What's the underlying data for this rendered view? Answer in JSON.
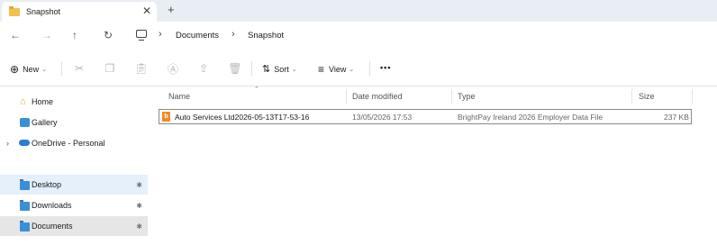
{
  "tab": {
    "title": "Snapshot",
    "close": "✕",
    "new_tab": "+"
  },
  "nav": {
    "back": "←",
    "forward": "→",
    "up": "↑",
    "refresh": "↻"
  },
  "breadcrumb": {
    "sep": "›",
    "items": [
      "Documents",
      "Snapshot"
    ]
  },
  "toolbar": {
    "new_label": "New",
    "new_icon": "⊕",
    "sort_label": "Sort",
    "sort_icon": "⇅",
    "view_label": "View",
    "view_icon": "≡",
    "more": "•••",
    "chevron": "⌄",
    "icons": [
      "cut-icon",
      "copy-icon",
      "paste-icon",
      "rename-icon",
      "share-icon",
      "delete-icon"
    ]
  },
  "sidebar": {
    "pin": "✱",
    "expand": "›",
    "items": [
      {
        "label": "Home",
        "icon": "home-icon"
      },
      {
        "label": "Gallery",
        "icon": "gallery-icon"
      },
      {
        "label": "OneDrive - Personal",
        "icon": "cloud-icon"
      },
      {
        "label": "Desktop",
        "icon": "desktop-folder-icon",
        "pinned": true
      },
      {
        "label": "Downloads",
        "icon": "downloads-folder-icon",
        "pinned": true
      },
      {
        "label": "Documents",
        "icon": "documents-folder-icon",
        "pinned": true
      }
    ]
  },
  "columns": {
    "name": "Name",
    "date": "Date modified",
    "type": "Type",
    "size": "Size"
  },
  "files": [
    {
      "name": "Auto Services Ltd2026-05-13T17-53-16",
      "icon_glyph": "b",
      "date": "13/05/2026 17:53",
      "type": "BrightPay Ireland 2026 Employer Data File",
      "size": "237 KB"
    }
  ],
  "colors": {
    "accent": "#3a8fd6",
    "file_icon": "#f08a24",
    "selected_bg": "#e5f0fb"
  }
}
